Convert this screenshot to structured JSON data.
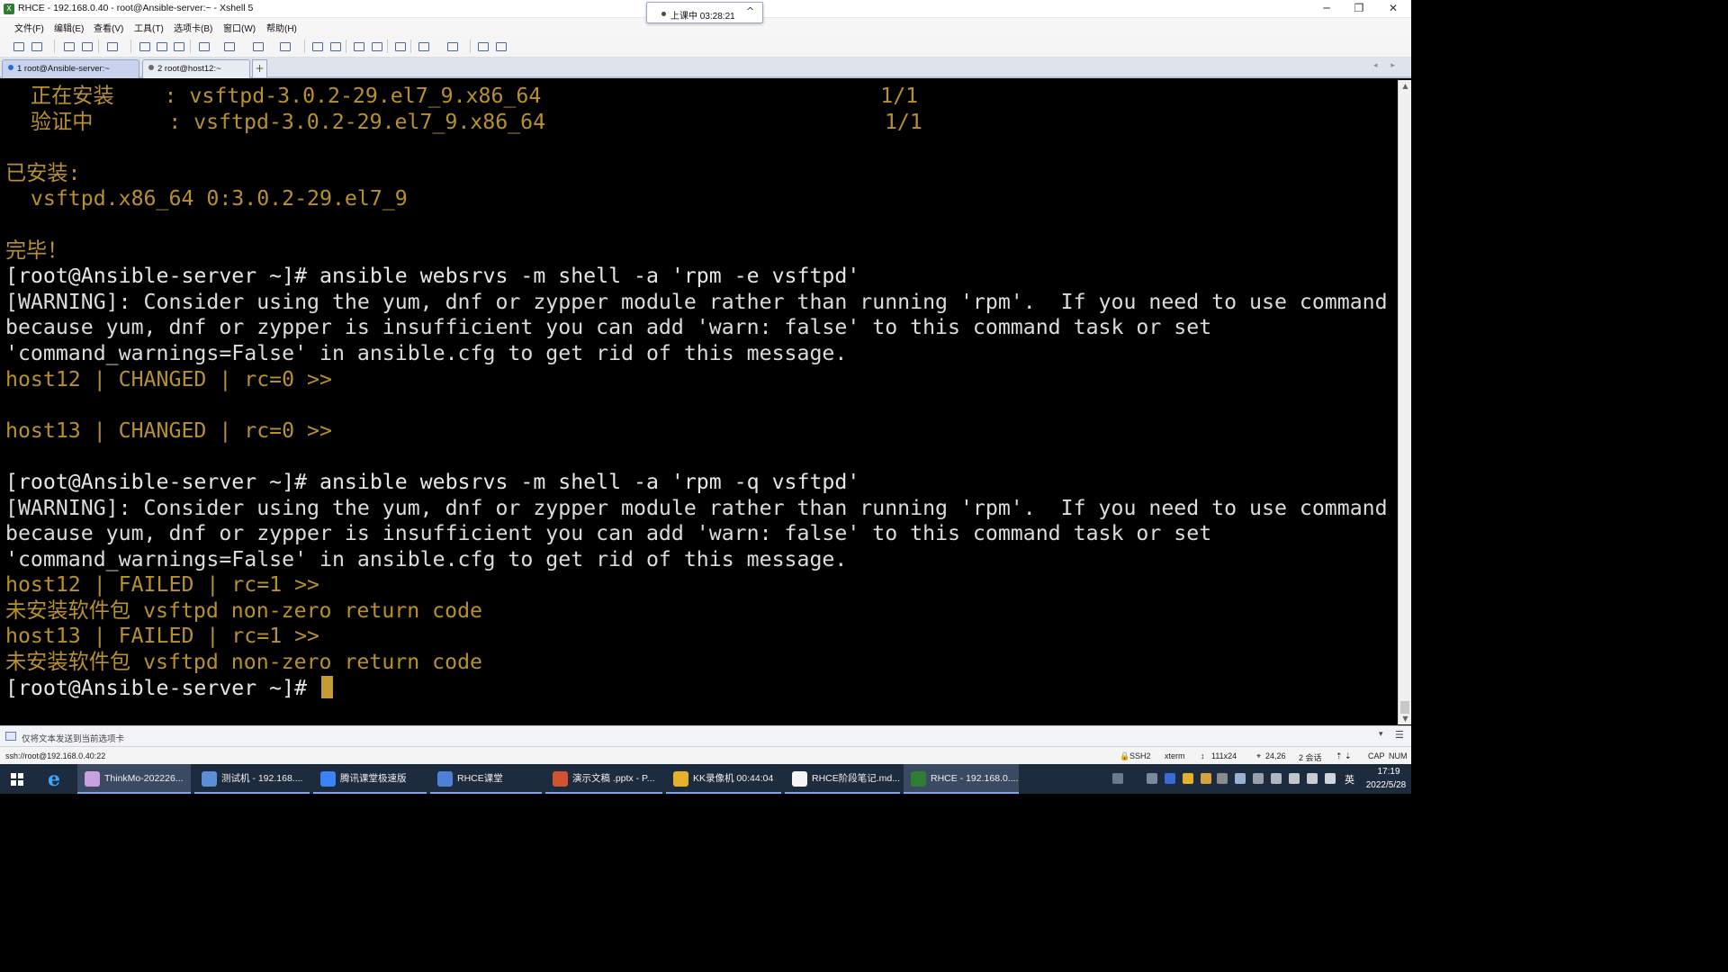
{
  "window": {
    "title": "RHCE - 192.168.0.40 - root@Ansible-server:~ - Xshell 5",
    "minimize": "─",
    "maximize": "❐",
    "close": "✕"
  },
  "timer": {
    "label": "上课中 03:28:21",
    "chevron": "^"
  },
  "menu": [
    "文件(F)",
    "编辑(E)",
    "查看(V)",
    "工具(T)",
    "选项卡(B)",
    "窗口(W)",
    "帮助(H)"
  ],
  "tabs": [
    {
      "label": "1 root@Ansible-server:~",
      "active": true
    },
    {
      "label": "2 root@host12:~",
      "active": false
    }
  ],
  "tab_add": "+",
  "tab_nav": "◂ ▸",
  "terminal": {
    "lines": [
      {
        "text": "  正在安装    : vsftpd-3.0.2-29.el7_9.x86_64                           1/1",
        "color": "yellow"
      },
      {
        "text": "  验证中      : vsftpd-3.0.2-29.el7_9.x86_64                           1/1",
        "color": "yellow"
      },
      {
        "text": "",
        "color": "yellow"
      },
      {
        "text": "已安装:",
        "color": "yellow"
      },
      {
        "text": "  vsftpd.x86_64 0:3.0.2-29.el7_9",
        "color": "yellow"
      },
      {
        "text": "",
        "color": "yellow"
      },
      {
        "text": "完毕！",
        "color": "yellow"
      },
      {
        "text": "[root@Ansible-server ~]# ansible websrvs -m shell -a 'rpm -e vsftpd'",
        "color": "white"
      },
      {
        "text": "[WARNING]: Consider using the yum, dnf or zypper module rather than running 'rpm'.  If you need to use command",
        "color": "warn"
      },
      {
        "text": "because yum, dnf or zypper is insufficient you can add 'warn: false' to this command task or set",
        "color": "warn"
      },
      {
        "text": "'command_warnings=False' in ansible.cfg to get rid of this message.",
        "color": "warn"
      },
      {
        "text": "host12 | CHANGED | rc=0 >>",
        "color": "yellow"
      },
      {
        "text": "",
        "color": "yellow"
      },
      {
        "text": "host13 | CHANGED | rc=0 >>",
        "color": "yellow"
      },
      {
        "text": "",
        "color": "yellow"
      },
      {
        "text": "[root@Ansible-server ~]# ansible websrvs -m shell -a 'rpm -q vsftpd'",
        "color": "white"
      },
      {
        "text": "[WARNING]: Consider using the yum, dnf or zypper module rather than running 'rpm'.  If you need to use command",
        "color": "warn"
      },
      {
        "text": "because yum, dnf or zypper is insufficient you can add 'warn: false' to this command task or set",
        "color": "warn"
      },
      {
        "text": "'command_warnings=False' in ansible.cfg to get rid of this message.",
        "color": "warn"
      },
      {
        "text": "host12 | FAILED | rc=1 >>",
        "color": "yellow"
      },
      {
        "text": "未安装软件包 vsftpd non-zero return code",
        "color": "yellow"
      },
      {
        "text": "host13 | FAILED | rc=1 >>",
        "color": "yellow"
      },
      {
        "text": "未安装软件包 vsftpd non-zero return code",
        "color": "yellow"
      }
    ],
    "prompt": "[root@Ansible-server ~]# ",
    "colors": {
      "yellow": "#b8912c",
      "white": "#e6e6e6",
      "warn": "#dcdcdc",
      "cursor": "#c39a34"
    }
  },
  "compose_bar": {
    "text": "仅将文本发送到当前选项卡",
    "menu_glyph": "▾",
    "list_glyph": "☰"
  },
  "status_bar": {
    "connection": "ssh://root@192.168.0.40:22",
    "protocol": "SSH2",
    "terminal_type": "xterm",
    "size": "111x24",
    "cursor_pos": "24,26",
    "sessions": "2 会话",
    "caps": "CAP",
    "num": "NUM"
  },
  "taskbar": {
    "tasks": [
      {
        "label": "ThinkMo-202226...",
        "icon_color": "#c8a2e0",
        "active": true
      },
      {
        "label": "测试机 - 192.168....",
        "icon_color": "#5a8fd8",
        "active": false
      },
      {
        "label": "腾讯课堂极速版",
        "icon_color": "#3b82f6",
        "active": false
      },
      {
        "label": "RHCE课堂",
        "icon_color": "#4f7fd6",
        "active": false
      },
      {
        "label": "演示文稿 .pptx - P...",
        "icon_color": "#d35230",
        "active": false
      },
      {
        "label": "KK录像机 00:44:04",
        "icon_color": "#e6b12a",
        "active": false
      },
      {
        "label": "RHCE阶段笔记.md...",
        "icon_color": "#f5f5f5",
        "active": false
      },
      {
        "label": "RHCE - 192.168.0....",
        "icon_color": "#2f7d32",
        "active": true
      }
    ],
    "ime": "英",
    "time": "17:19",
    "date": "2022/5/28"
  },
  "icons": {
    "start": "windows-start-icon",
    "ie": "internet-explorer-icon"
  }
}
